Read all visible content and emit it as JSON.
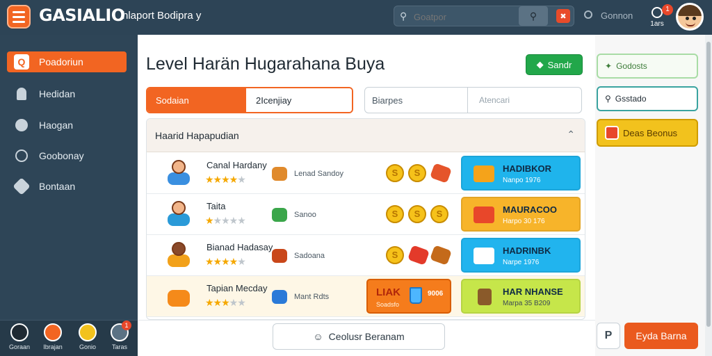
{
  "header": {
    "logo": "GASIALIO",
    "subtitle": "hlaport Bodipra y",
    "search_placeholder": "Goatpor",
    "status": "Gonnon",
    "notification_count": "1",
    "notification_label": "1ars"
  },
  "sidebar": {
    "items": [
      {
        "label": "Poadoriun",
        "icon": "home-icon",
        "active": true
      },
      {
        "label": "Hedidan",
        "icon": "person-icon",
        "active": false
      },
      {
        "label": "Haogan",
        "icon": "chat-icon",
        "active": false
      },
      {
        "label": "Goobonay",
        "icon": "shield-icon",
        "active": false
      },
      {
        "label": "Bontaan",
        "icon": "gear-icon",
        "active": false
      }
    ],
    "dock": [
      {
        "label": "Goraan",
        "badge": ""
      },
      {
        "label": "Ibrajan",
        "badge": ""
      },
      {
        "label": "Gonio",
        "badge": ""
      },
      {
        "label": "Taras",
        "badge": "1"
      }
    ]
  },
  "main": {
    "title": "Level Harän Hugarahana  Buya",
    "action_button": "Sandr",
    "tabs": [
      "Sodaian",
      "2Icenjiay"
    ],
    "filters": [
      "Biarpes",
      "Atencari"
    ],
    "list_header": "Haarid Hapapudian",
    "rows": [
      {
        "name": "Canal Hardany",
        "stars": 4,
        "item": "Lenad Sandoy",
        "reward_title": "HADIBKOR",
        "reward_sub": "Nanpo 1976",
        "reward_color": "#1fb4ec"
      },
      {
        "name": "Taita",
        "stars": 1,
        "item": "Sanoo",
        "reward_title": "MAURACOO",
        "reward_sub": "Harpo 30 176",
        "reward_color": "#f7b42a"
      },
      {
        "name": "Bianad Hadasay",
        "stars": 4,
        "item": "Sadoana",
        "reward_title": "HADRINBK",
        "reward_sub": "Narpe 1976",
        "reward_color": "#21b4ee"
      },
      {
        "name": "Tapian Mecday",
        "stars": 3,
        "item": "Mant Rdts",
        "reward_title": "HAR NHANSE",
        "reward_sub": "Marpa 35 B209",
        "reward_color": "#c6e64a",
        "promo_title": "LIAK",
        "promo_sub": "Soadsfo",
        "promo_value": "9006"
      }
    ],
    "footer_button": "Ceolusr Beranam"
  },
  "right_panel": {
    "buttons": [
      "Godosts",
      "Gsstado",
      "Deas Beonus"
    ],
    "help_label": "P",
    "primary_button": "Eyda Barna"
  }
}
